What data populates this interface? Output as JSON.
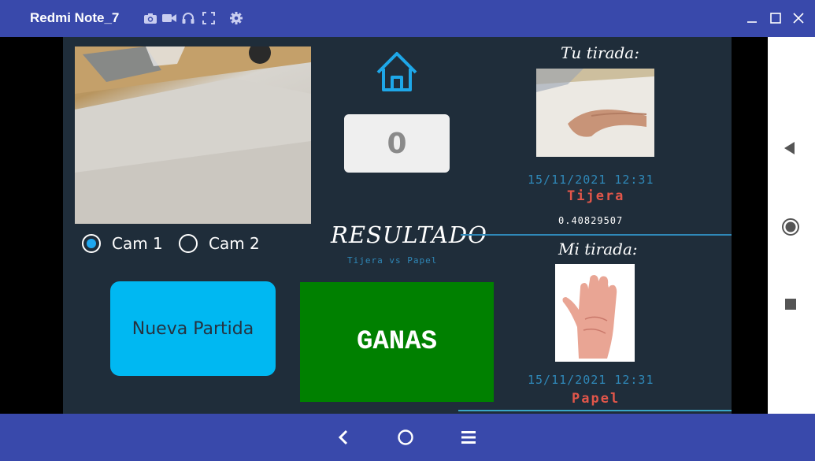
{
  "window": {
    "title": "Redmi Note_7",
    "toolbar_icons": [
      "camera-icon",
      "video-icon",
      "headphones-icon",
      "fullscreen-icon",
      "settings-icon"
    ],
    "controls": [
      "minimize-icon",
      "maximize-icon",
      "close-icon"
    ]
  },
  "colors": {
    "window_bar": "#3949ab",
    "app_background": "#1f2d3a",
    "accent_blue": "#00b8f2",
    "win_green": "#008000",
    "move_red": "#e2564a",
    "date_blue": "#2f88b8"
  },
  "camera": {
    "options": [
      {
        "label": "Cam 1",
        "selected": true
      },
      {
        "label": "Cam 2",
        "selected": false
      }
    ]
  },
  "buttons": {
    "new_game": "Nueva Partida"
  },
  "score_counter": "0",
  "result": {
    "heading": "RESULTADO",
    "matchup": "Tijera vs Papel",
    "outcome": "GANAS"
  },
  "player": {
    "heading": "Tu tirada:",
    "timestamp": "15/11/2021 12:31",
    "move": "Tijera",
    "confidence": "0.40829507"
  },
  "machine": {
    "heading": "Mi tirada:",
    "timestamp": "15/11/2021 12:31",
    "move": "Papel"
  },
  "side_nav": [
    "back-triangle-icon",
    "home-circle-icon",
    "recents-square-icon"
  ],
  "bottom_nav": [
    "back-chevron-icon",
    "home-circle-icon",
    "menu-icon"
  ]
}
